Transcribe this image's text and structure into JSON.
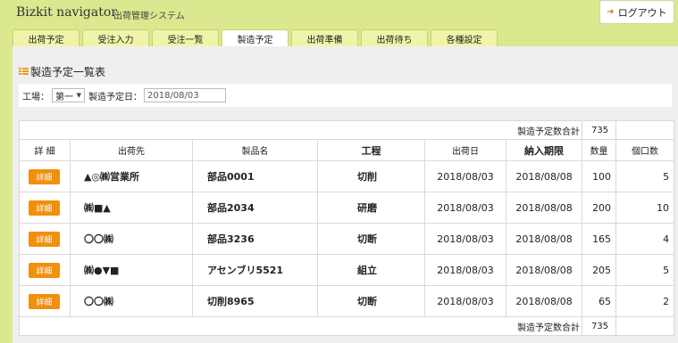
{
  "header": {
    "app_title": "Bizkit navigator",
    "app_subtitle": "出荷管理システム",
    "logout_label": "ログアウト"
  },
  "tabs": [
    {
      "label": "出荷予定",
      "active": false
    },
    {
      "label": "受注入力",
      "active": false
    },
    {
      "label": "受注一覧",
      "active": false
    },
    {
      "label": "製造予定",
      "active": true
    },
    {
      "label": "出荷準備",
      "active": false
    },
    {
      "label": "出荷待ち",
      "active": false
    },
    {
      "label": "各種設定",
      "active": false
    }
  ],
  "page": {
    "title": "製造予定一覧表"
  },
  "filters": {
    "factory_label": "工場：",
    "factory_value": "第一",
    "date_label": "製造予定日：",
    "date_value": "2018/08/03"
  },
  "table": {
    "total_label": "製造予定数合計",
    "total_value": "735",
    "headers": {
      "detail": "詳 細",
      "destination": "出荷先",
      "product": "製品名",
      "process": "工程",
      "ship_date": "出荷日",
      "deadline": "納入期限",
      "quantity": "数量",
      "packages": "個口数"
    },
    "detail_button": "詳細",
    "rows": [
      {
        "destination": "▲◎㈱営業所",
        "product": "部品0001",
        "process": "切削",
        "ship_date": "2018/08/03",
        "deadline": "2018/08/08",
        "quantity": "100",
        "packages": "5"
      },
      {
        "destination": "㈱■▲",
        "product": "部品2034",
        "process": "研磨",
        "ship_date": "2018/08/03",
        "deadline": "2018/08/08",
        "quantity": "200",
        "packages": "10"
      },
      {
        "destination": "〇〇㈱",
        "product": "部品3236",
        "process": "切断",
        "ship_date": "2018/08/03",
        "deadline": "2018/08/08",
        "quantity": "165",
        "packages": "4"
      },
      {
        "destination": "㈱●▼■",
        "product": "アセンブリ5521",
        "process": "組立",
        "ship_date": "2018/08/03",
        "deadline": "2018/08/08",
        "quantity": "205",
        "packages": "5"
      },
      {
        "destination": "〇〇㈱",
        "product": "切削8965",
        "process": "切断",
        "ship_date": "2018/08/03",
        "deadline": "2018/08/08",
        "quantity": "65",
        "packages": "2"
      }
    ]
  },
  "colors": {
    "header_bg": "#dbe88f",
    "tab_bg": "#f0f4a9",
    "accent_orange": "#f0900c",
    "panel_bg": "#efefef"
  }
}
